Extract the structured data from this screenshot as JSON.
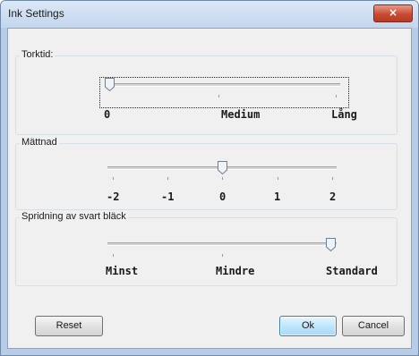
{
  "window": {
    "title": "Ink Settings",
    "close_label": "×"
  },
  "dry_time": {
    "label": "Torktid:",
    "tick_labels": [
      "0",
      "Medium",
      "Lång"
    ],
    "level": 0
  },
  "saturation": {
    "label": "Mättnad",
    "tick_labels": [
      "-2",
      "-1",
      "0",
      "1",
      "2"
    ],
    "value": 0
  },
  "black_bleed": {
    "label": "Spridning av svart bläck",
    "tick_labels": [
      "Minst",
      "Mindre",
      "Standard"
    ],
    "value": "Standard"
  },
  "buttons": {
    "reset": "Reset",
    "ok": "Ok",
    "cancel": "Cancel"
  },
  "colors": {
    "accent": "#3c7fb1",
    "close": "#c94a33",
    "frame": "#b7cde7"
  }
}
